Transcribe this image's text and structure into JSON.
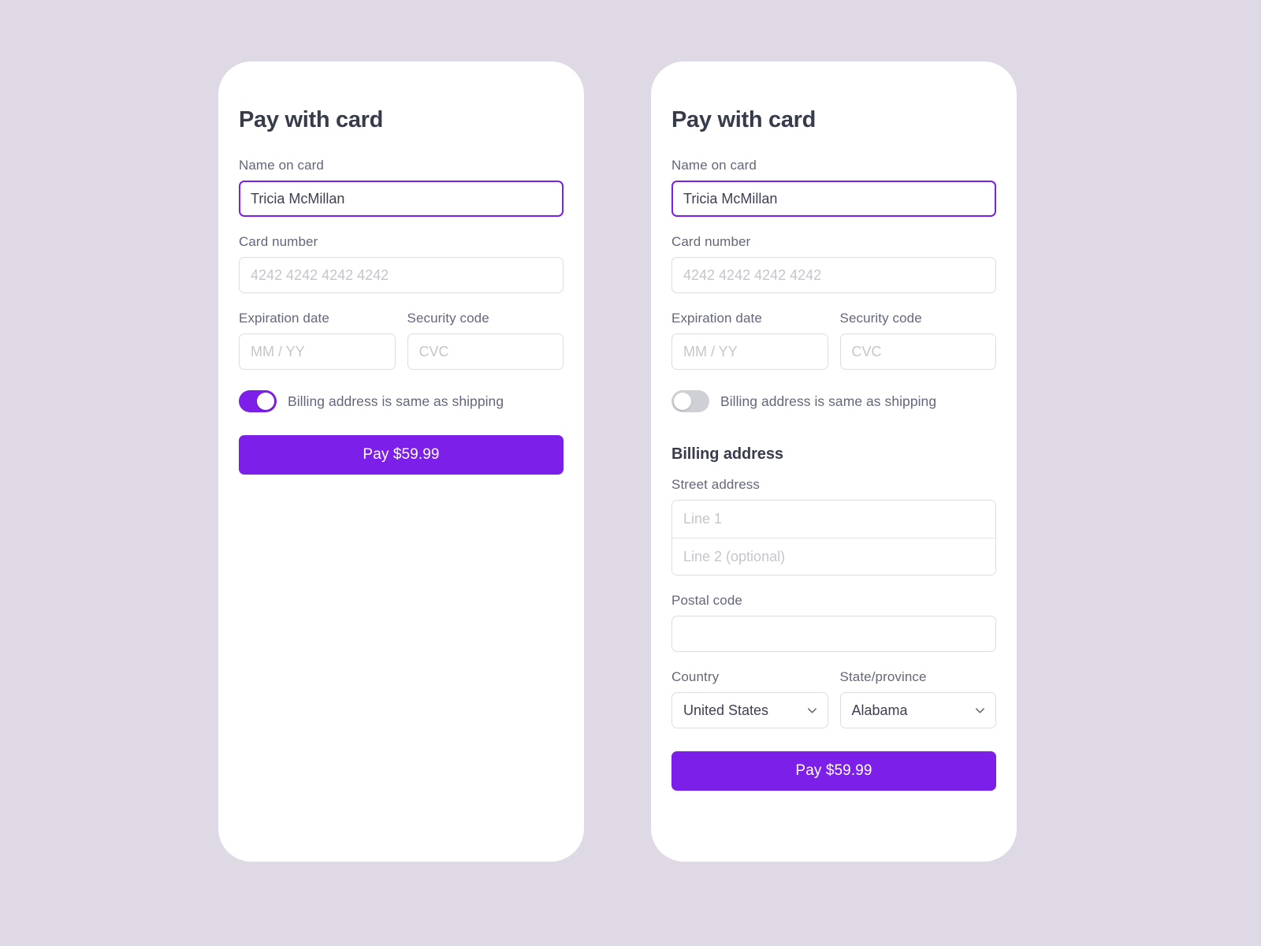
{
  "theme": {
    "page_background": "#ded9e4",
    "card_background": "#ffffff",
    "accent": "#7c1fe8",
    "heading_color": "#373c4b",
    "label_color": "#63677a",
    "border_color": "#dcdde2",
    "placeholder_color": "#c4c6cd",
    "toggle_off_color": "#cfd0d6"
  },
  "screens": [
    {
      "id": "collapsed",
      "title": "Pay with card",
      "name_on_card": {
        "label": "Name on card",
        "value": "Tricia McMillan",
        "placeholder": "",
        "focused": true
      },
      "card_number": {
        "label": "Card number",
        "value": "",
        "placeholder": "4242 4242 4242 4242"
      },
      "expiration": {
        "label": "Expiration date",
        "value": "",
        "placeholder": "MM / YY"
      },
      "security_code": {
        "label": "Security code",
        "value": "",
        "placeholder": "CVC"
      },
      "billing_toggle": {
        "label": "Billing address is same as shipping",
        "state": "on"
      },
      "pay_button": {
        "label": "Pay $59.99",
        "amount": "$59.99"
      }
    },
    {
      "id": "expanded",
      "title": "Pay with card",
      "name_on_card": {
        "label": "Name on card",
        "value": "Tricia McMillan",
        "placeholder": "",
        "focused": true
      },
      "card_number": {
        "label": "Card number",
        "value": "",
        "placeholder": "4242 4242 4242 4242"
      },
      "expiration": {
        "label": "Expiration date",
        "value": "",
        "placeholder": "MM / YY"
      },
      "security_code": {
        "label": "Security code",
        "value": "",
        "placeholder": "CVC"
      },
      "billing_toggle": {
        "label": "Billing address is same as shipping",
        "state": "off"
      },
      "billing_address": {
        "heading": "Billing address",
        "street": {
          "label": "Street address",
          "line1": {
            "value": "",
            "placeholder": "Line 1"
          },
          "line2": {
            "value": "",
            "placeholder": "Line 2 (optional)"
          }
        },
        "postal_code": {
          "label": "Postal code",
          "value": "",
          "placeholder": ""
        },
        "country": {
          "label": "Country",
          "selected": "United States",
          "options": [
            "United States"
          ]
        },
        "state_province": {
          "label": "State/province",
          "selected": "Alabama",
          "options": [
            "Alabama"
          ]
        }
      },
      "pay_button": {
        "label": "Pay $59.99",
        "amount": "$59.99"
      }
    }
  ]
}
